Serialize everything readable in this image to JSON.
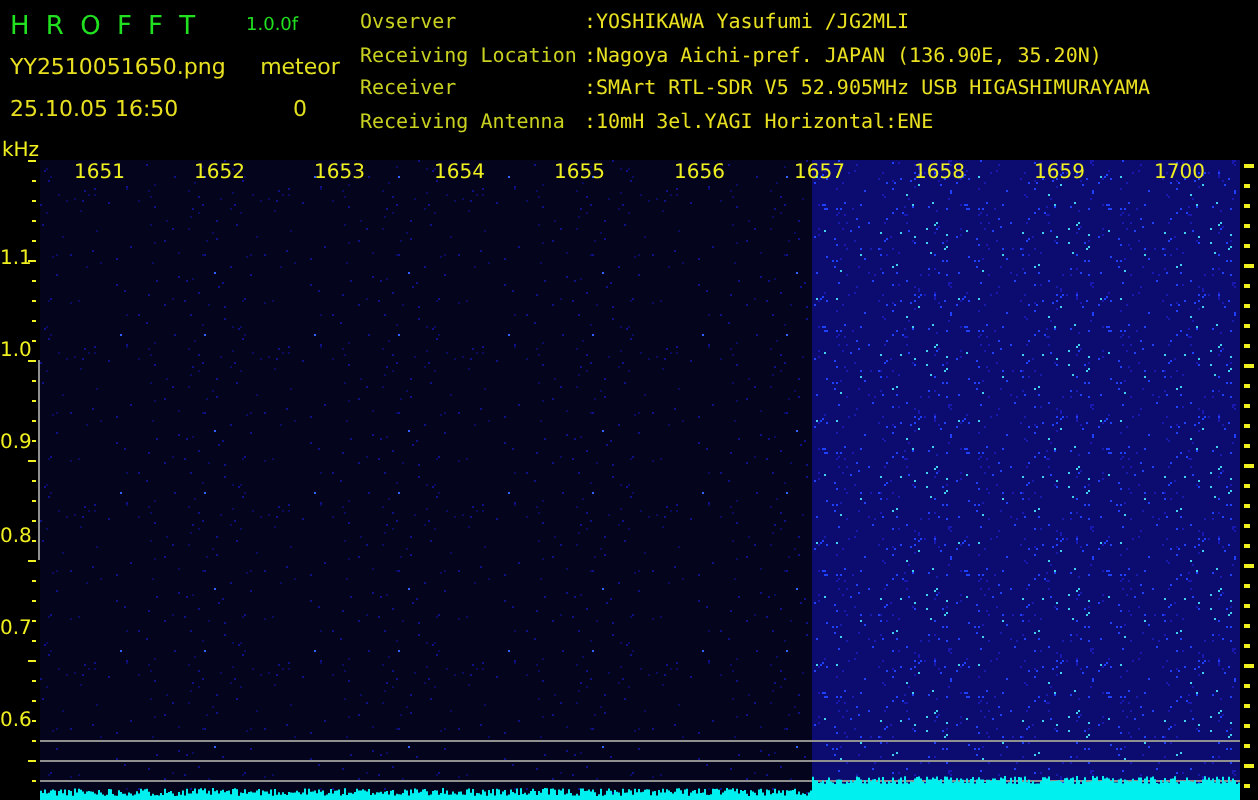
{
  "header": {
    "title": "H R O F F T",
    "version": "1.0.0f",
    "filename": "YY2510051650.png",
    "datetime": "25.10.05 16:50",
    "counter_label": "meteor",
    "counter_value": "0"
  },
  "info": [
    {
      "label": "Ovserver",
      "value": ":YOSHIKAWA Yasufumi /JG2MLI"
    },
    {
      "label": "Receiving Location",
      "value": ":Nagoya Aichi-pref. JAPAN (136.90E, 35.20N)"
    },
    {
      "label": "Receiver",
      "value": ":SMArt RTL-SDR V5 52.905MHz USB HIGASHIMURAYAMA"
    },
    {
      "label": "Receiving Antenna",
      "value": ":10mH 3el.YAGI Horizontal:ENE"
    }
  ],
  "spectrogram": {
    "unit": "kHz",
    "frequency_labels": [
      "1.1",
      "1.0",
      "0.9",
      "0.8",
      "0.7",
      "0.6"
    ],
    "time_labels": [
      "1651",
      "1652",
      "1653",
      "1654",
      "1655",
      "1656",
      "1657",
      "1658",
      "1659",
      "1700"
    ]
  }
}
